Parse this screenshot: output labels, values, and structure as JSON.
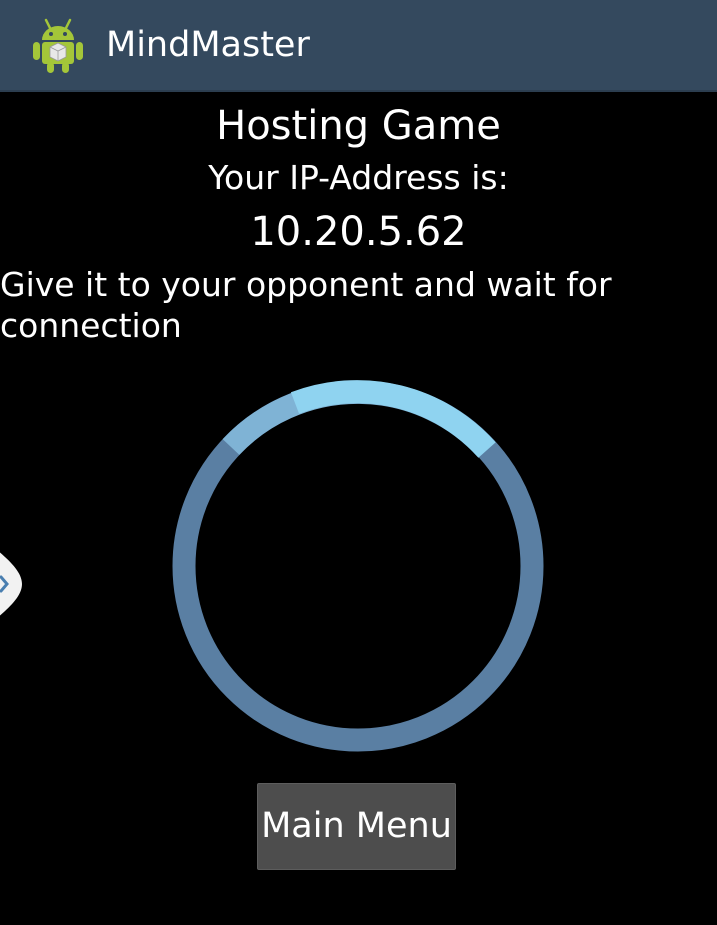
{
  "app": {
    "title": "MindMaster",
    "icon": "android-robot-icon"
  },
  "screen": {
    "title": "Hosting Game",
    "ip_label": "Your IP-Address is:",
    "ip_address": "10.20.5.62",
    "instructions": "Give it to your opponent and wait for connection"
  },
  "spinner": {
    "icon": "progress-spinner-icon"
  },
  "side_handle": {
    "icon": "chevron-right-icon"
  },
  "buttons": {
    "main_menu": "Main Menu"
  },
  "colors": {
    "action_bar": "#34495e",
    "background": "#000000",
    "button": "#4d4d4d",
    "spinner_light": "#8fd3f0",
    "spinner_dark": "#5a7fa3"
  }
}
